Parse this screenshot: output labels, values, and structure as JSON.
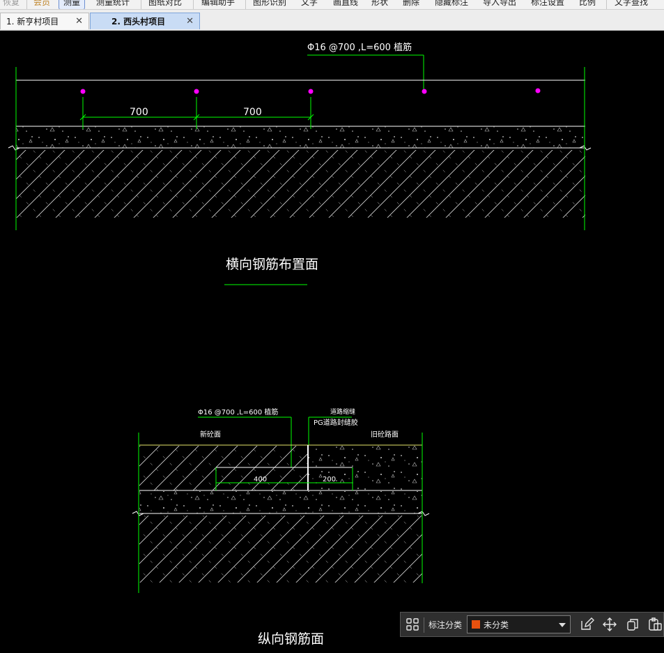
{
  "menubar": {
    "items": [
      "恢复",
      "会员",
      "测量",
      "测量统计",
      "图纸对比",
      "编辑助手",
      "图形识别",
      "文字",
      "画直线",
      "形状",
      "删除",
      "隐藏标注",
      "导入导出",
      "标注设置",
      "比例",
      "文字查找"
    ],
    "active": "测量",
    "member_color": "#c0862b"
  },
  "tabs": [
    {
      "label": "1. 新亨村项目",
      "close": "✕",
      "active": false
    },
    {
      "label": "2. 西头村项目",
      "close": "✕",
      "active": true
    }
  ],
  "drawing": {
    "view1": {
      "callout": "Φ16 @700 ,L=600 植筋",
      "dim1": "700",
      "dim2": "700",
      "title": "横向钢筋布置面"
    },
    "view2": {
      "callout": "Φ16 @700 ,L=600 植筋",
      "joint_note_line1": "道路缩缝",
      "joint_note_line2": "PG道路封缝胶",
      "label_new": "新砼面",
      "label_old": "旧砼路面",
      "dim1": "400",
      "dim2": "200",
      "title": "纵向钢筋面"
    },
    "colors": {
      "line": "#ffffff",
      "dimension": "#00ff00",
      "rebar_dot": "#ff00ff",
      "pavement_line": "#e5e36a"
    }
  },
  "annotation_toolbar": {
    "label": "标注分类",
    "selected": "未分类",
    "swatch_color": "#e8510f",
    "icons": [
      "grid-icon",
      "edit-icon",
      "move-icon",
      "copy-icon",
      "paste-icon"
    ]
  }
}
